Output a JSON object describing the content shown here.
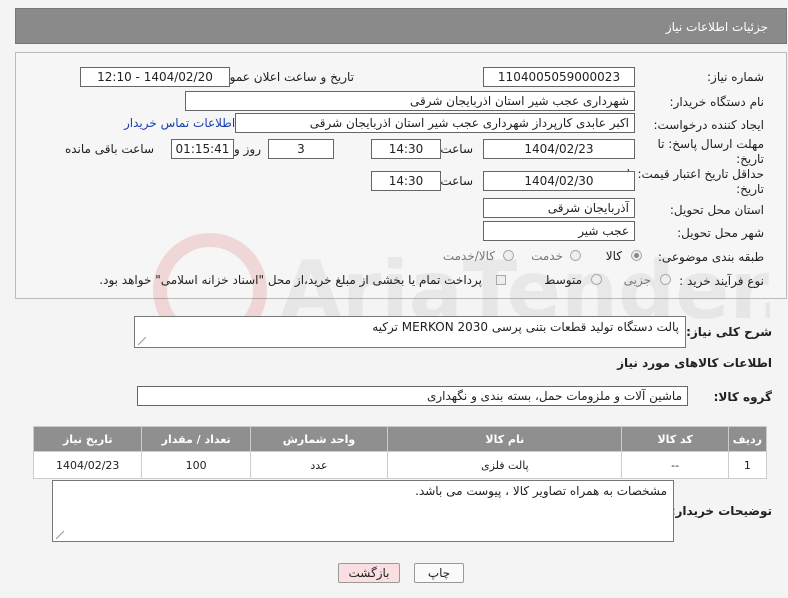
{
  "header": {
    "title": "جزئیات اطلاعات نیاز"
  },
  "fields": {
    "need_number_label": "شماره نیاز:",
    "need_number": "1104005059000023",
    "announce_label": "تاریخ و ساعت اعلان عمومی:",
    "announce_value": "1404/02/20 - 12:10",
    "buyer_org_label": "نام دستگاه خریدار:",
    "buyer_org": "شهرداری عجب شیر استان اذربایجان شرقی",
    "creator_label": "ایجاد کننده درخواست:",
    "creator": "اکبر عابدی کارپرداز شهرداری عجب شیر استان اذربایجان شرقی",
    "contact_link": "اطلاعات تماس خریدار",
    "deadline_label": "مهلت ارسال پاسخ: تا تاریخ:",
    "deadline_date": "1404/02/23",
    "time_label": "ساعت",
    "deadline_time": "14:30",
    "days": "3",
    "days_label": "روز و",
    "remaining": "01:15:41",
    "remaining_label": "ساعت باقی مانده",
    "validity_label": "حداقل تاریخ اعتبار قیمت: تا تاریخ:",
    "validity_date": "1404/02/30",
    "validity_time": "14:30",
    "province_label": "استان محل تحویل:",
    "province": "آذربایجان شرقی",
    "city_label": "شهر محل تحویل:",
    "city": "عجب شیر",
    "category_label": "طبقه بندی موضوعی:",
    "category_options": [
      "کالا",
      "خدمت",
      "کالا/خدمت"
    ],
    "process_label": "نوع فرآیند خرید :",
    "process_options": [
      "جزیی",
      "متوسط"
    ],
    "payment_note": "پرداخت تمام یا بخشی از مبلغ خرید،از محل \"اسناد خزانه اسلامی\" خواهد بود."
  },
  "description": {
    "label": "شرح کلی نیاز:",
    "value": "پالت دستگاه تولید قطعات بتنی پرسی MERKON 2030  ترکیه"
  },
  "goods": {
    "section_title": "اطلاعات کالاهای مورد نیاز",
    "group_label": "گروه کالا:",
    "group_value": "ماشین آلات و ملزومات حمل، بسته بندی و نگهداری",
    "columns": [
      "ردیف",
      "کد کالا",
      "نام کالا",
      "واحد شمارش",
      "تعداد / مقدار",
      "تاریخ نیاز"
    ],
    "rows": [
      {
        "row": "1",
        "code": "--",
        "name": "پالت فلزی",
        "unit": "عدد",
        "qty": "100",
        "date": "1404/02/23"
      }
    ]
  },
  "buyer_notes": {
    "label": "توضیحات خریدار:",
    "value": "مشخصات به همراه تصاویر کالا ، پیوست می باشد."
  },
  "buttons": {
    "print": "چاپ",
    "back": "بازگشت"
  },
  "watermark_text": "AriaTender.neT"
}
